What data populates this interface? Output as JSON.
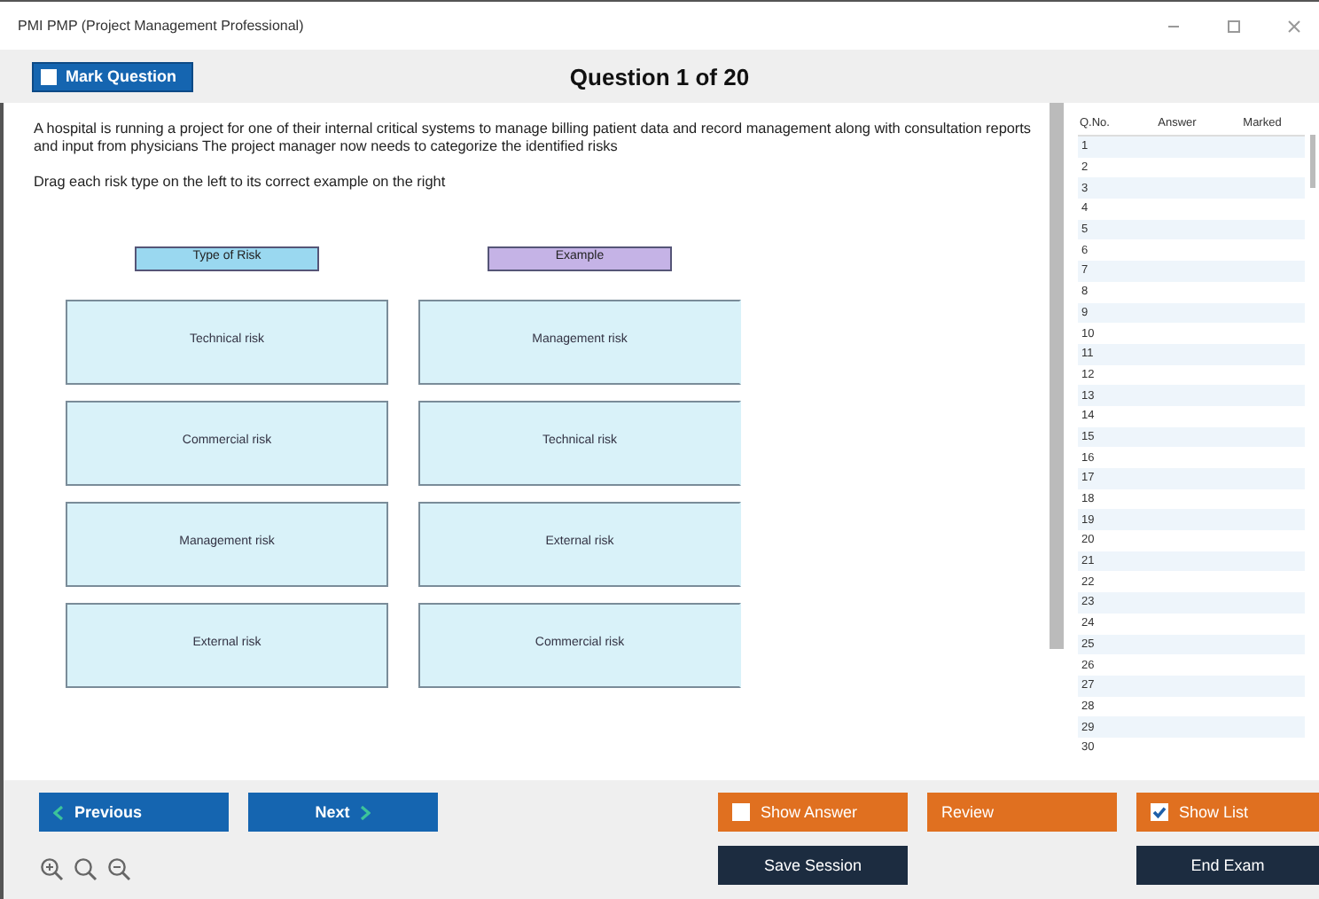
{
  "window": {
    "title": "PMI PMP (Project Management Professional)"
  },
  "header": {
    "mark_question": {
      "label": "Mark Question",
      "checked": false
    },
    "title": "Question 1 of 20"
  },
  "question": {
    "text": "A hospital is running a project for one of their internal critical systems to manage billing patient data and record management along with consultation reports and input from physicians The project manager now needs to categorize the identified risks",
    "instruction": "Drag each risk type on the left to its correct example on the right"
  },
  "matching": {
    "left_heading": "Type of Risk",
    "right_heading": "Example",
    "left_items": [
      "Technical risk",
      "Commercial risk",
      "Management risk",
      "External risk"
    ],
    "right_items": [
      "Management risk",
      "Technical risk",
      "External risk",
      "Commercial risk"
    ]
  },
  "question_list": {
    "columns": [
      "Q.No.",
      "Answer",
      "Marked"
    ],
    "rows": [
      {
        "q_no": "1"
      },
      {
        "q_no": "2"
      },
      {
        "q_no": "3"
      },
      {
        "q_no": "4"
      },
      {
        "q_no": "5"
      },
      {
        "q_no": "6"
      },
      {
        "q_no": "7"
      },
      {
        "q_no": "8"
      },
      {
        "q_no": "9"
      },
      {
        "q_no": "10"
      },
      {
        "q_no": "11"
      },
      {
        "q_no": "12"
      },
      {
        "q_no": "13"
      },
      {
        "q_no": "14"
      },
      {
        "q_no": "15"
      },
      {
        "q_no": "16"
      },
      {
        "q_no": "17"
      },
      {
        "q_no": "18"
      },
      {
        "q_no": "19"
      },
      {
        "q_no": "20"
      },
      {
        "q_no": "21"
      },
      {
        "q_no": "22"
      },
      {
        "q_no": "23"
      },
      {
        "q_no": "24"
      },
      {
        "q_no": "25"
      },
      {
        "q_no": "26"
      },
      {
        "q_no": "27"
      },
      {
        "q_no": "28"
      },
      {
        "q_no": "29"
      },
      {
        "q_no": "30"
      }
    ]
  },
  "footer": {
    "previous": "Previous",
    "next": "Next",
    "show_answer": {
      "label": "Show Answer",
      "checked": false
    },
    "review": "Review",
    "show_list": {
      "label": "Show List",
      "checked": true
    },
    "save_session": "Save Session",
    "end_exam": "End Exam"
  }
}
